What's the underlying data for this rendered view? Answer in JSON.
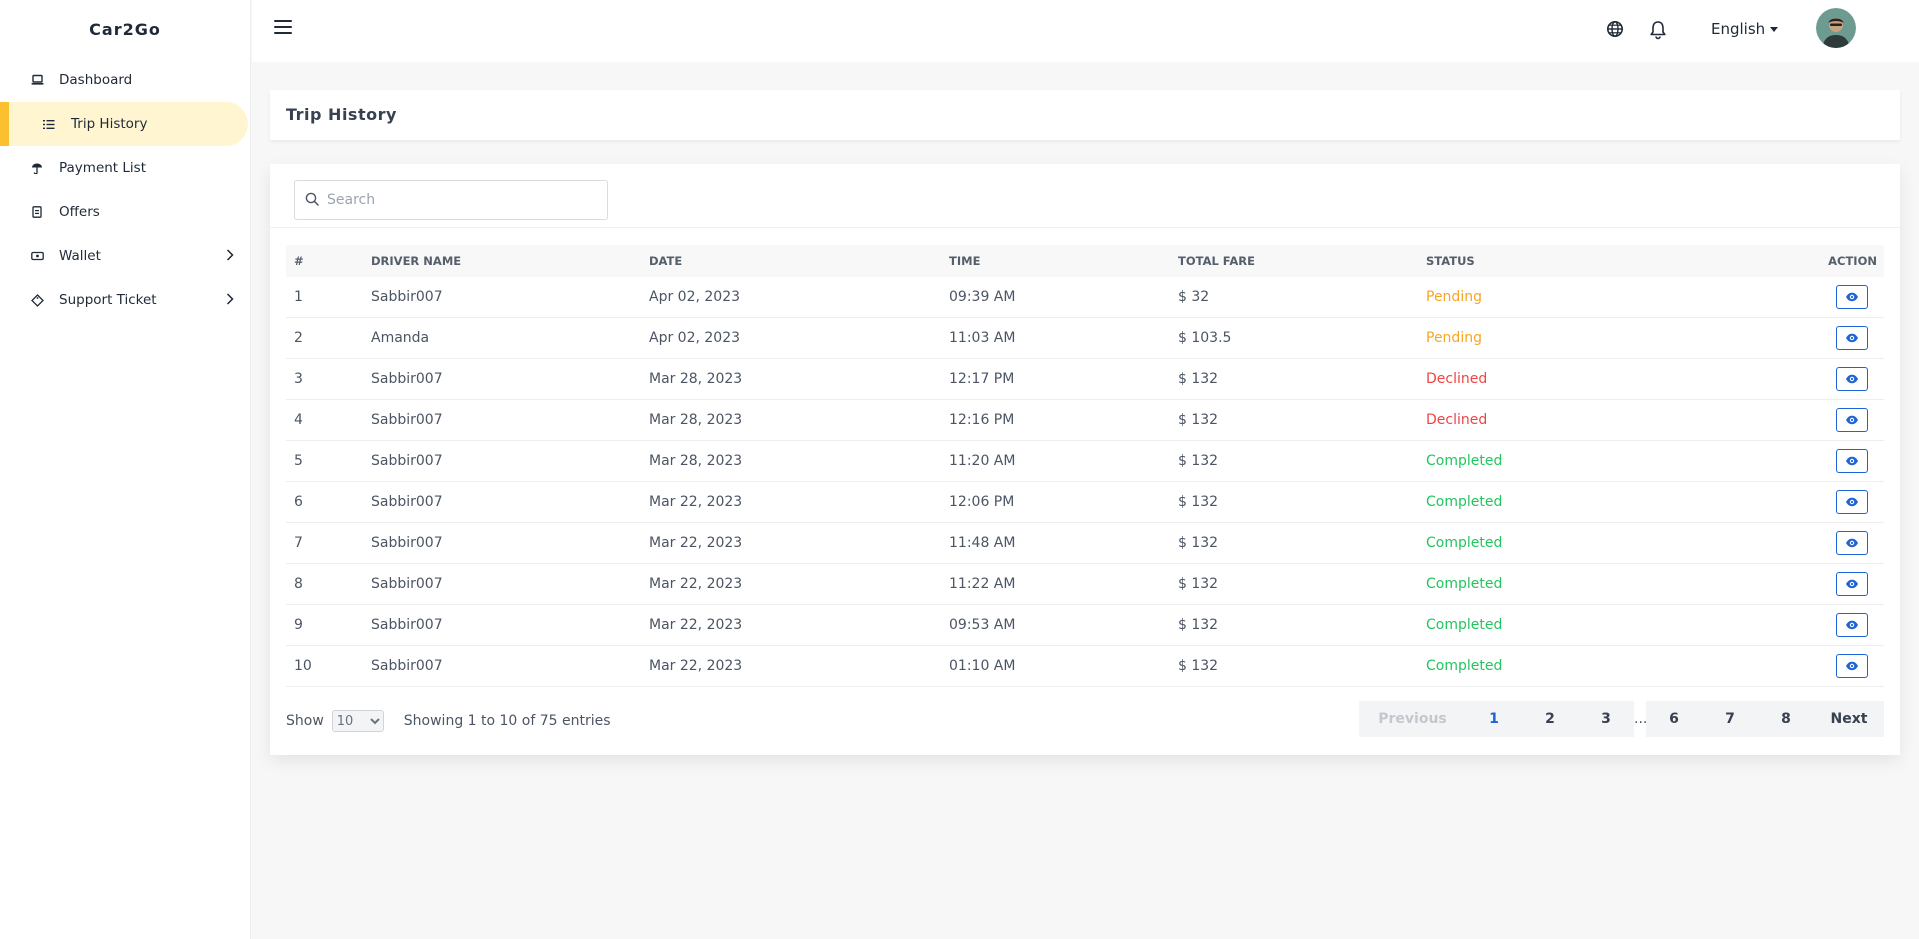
{
  "brand": "Car2Go",
  "sidebar": {
    "items": [
      {
        "label": "Dashboard",
        "icon": "laptop-icon"
      },
      {
        "label": "Trip History",
        "icon": "list-icon"
      },
      {
        "label": "Payment List",
        "icon": "umbrella-icon"
      },
      {
        "label": "Offers",
        "icon": "receipt-icon"
      },
      {
        "label": "Wallet",
        "icon": "wallet-icon"
      },
      {
        "label": "Support Ticket",
        "icon": "ticket-icon"
      }
    ]
  },
  "topbar": {
    "language": "English",
    "icons": [
      "menu-icon",
      "globe-icon",
      "bell-icon",
      "avatar"
    ]
  },
  "page_title": "Trip History",
  "search": {
    "placeholder": "Search",
    "value": ""
  },
  "table": {
    "headers": [
      "#",
      "DRIVER NAME",
      "DATE",
      "TIME",
      "TOTAL FARE",
      "STATUS",
      "ACTION"
    ],
    "rows": [
      [
        "1",
        "Sabbir007",
        "Apr 02, 2023",
        "09:39 AM",
        "$ 32",
        "Pending"
      ],
      [
        "2",
        "Amanda",
        "Apr 02, 2023",
        "11:03 AM",
        "$ 103.5",
        "Pending"
      ],
      [
        "3",
        "Sabbir007",
        "Mar 28, 2023",
        "12:17 PM",
        "$ 132",
        "Declined"
      ],
      [
        "4",
        "Sabbir007",
        "Mar 28, 2023",
        "12:16 PM",
        "$ 132",
        "Declined"
      ],
      [
        "5",
        "Sabbir007",
        "Mar 28, 2023",
        "11:20 AM",
        "$ 132",
        "Completed"
      ],
      [
        "6",
        "Sabbir007",
        "Mar 22, 2023",
        "12:06 PM",
        "$ 132",
        "Completed"
      ],
      [
        "7",
        "Sabbir007",
        "Mar 22, 2023",
        "11:48 AM",
        "$ 132",
        "Completed"
      ],
      [
        "8",
        "Sabbir007",
        "Mar 22, 2023",
        "11:22 AM",
        "$ 132",
        "Completed"
      ],
      [
        "9",
        "Sabbir007",
        "Mar 22, 2023",
        "09:53 AM",
        "$ 132",
        "Completed"
      ],
      [
        "10",
        "Sabbir007",
        "Mar 22, 2023",
        "01:10 AM",
        "$ 132",
        "Completed"
      ]
    ]
  },
  "footer": {
    "show_label": "Show",
    "page_size": "10",
    "page_size_options": [
      "10"
    ],
    "entries_text": "Showing 1 to 10 of 75 entries",
    "pagination": {
      "previous": "Previous",
      "pages": [
        "1",
        "2",
        "3",
        "6",
        "7",
        "8"
      ],
      "ellipsis": "...",
      "next": "Next",
      "current": "1"
    }
  },
  "colors": {
    "accent": "#fbc02d",
    "active_bg": "#fff6d1",
    "pending": "#f5a623",
    "declined": "#ef4444",
    "completed": "#22c55e",
    "link": "#1d64d6"
  }
}
